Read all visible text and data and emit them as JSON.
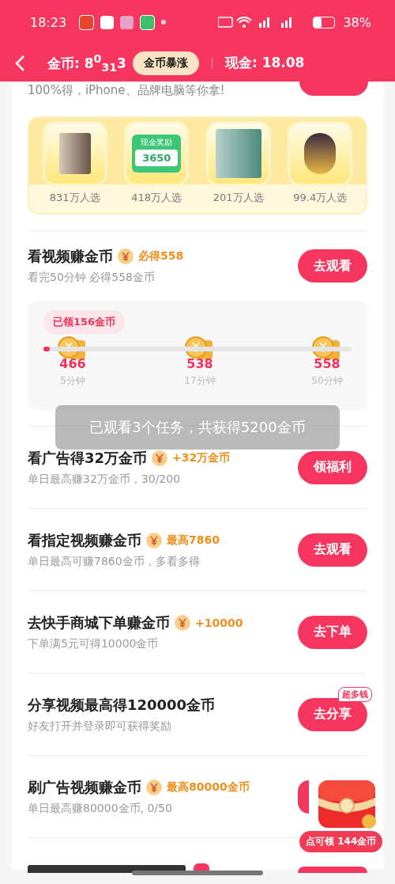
{
  "status_bar": {
    "time": "18:23",
    "battery": "38%"
  },
  "header": {
    "coins_label": "金币: 8$^{0}$$_{31}$3",
    "badge": "金币暴涨",
    "cash": "现金: 18.08"
  },
  "intro": {
    "text": "100%得，iPhone、品牌电脑等你拿!"
  },
  "prizes": [
    {
      "kind": "phone",
      "count": "831万人选"
    },
    {
      "kind": "cash",
      "caption": "现金奖励",
      "amount": "3650",
      "count": "418万人选"
    },
    {
      "kind": "phone2",
      "count": "201万人选"
    },
    {
      "kind": "coins",
      "count": "99.4万人选"
    }
  ],
  "video_task": {
    "title": "看视频赚金币",
    "reward": "必得558",
    "subtitle": "看完50分钟 必得558金币",
    "button": "去观看",
    "claimed": "已领156金币",
    "level": 0.02,
    "milestones": [
      {
        "coins": "466",
        "time": "5分钟"
      },
      {
        "coins": "538",
        "time": "17分钟"
      },
      {
        "coins": "558",
        "time": "50分钟"
      }
    ]
  },
  "tasks": [
    {
      "title": "看广告得32万金币",
      "reward": "+32万金币",
      "subtitle": "单日最高赚32万金币，30/200",
      "button": "领福利"
    },
    {
      "title": "看指定视频赚金币",
      "reward": "最高7860",
      "subtitle": "单日最高可赚7860金币，多看多得",
      "button": "去观看"
    },
    {
      "title": "去快手商城下单赚金币",
      "reward": "+10000",
      "subtitle": "下单满5元可得10000金币",
      "button": "去下单"
    },
    {
      "title": "分享视频最高得120000金币",
      "subtitle": "好友打开并登录即可获得奖励",
      "button": "去分享",
      "tag": "超多钱"
    },
    {
      "title": "刷广告视频赚金币",
      "reward": "最高80000金币",
      "subtitle": "单日最高赚80000金币, 0/50"
    }
  ],
  "toast": "已观看3个任务，共获得5200金币",
  "chest": {
    "label": "点可领 144金币"
  }
}
